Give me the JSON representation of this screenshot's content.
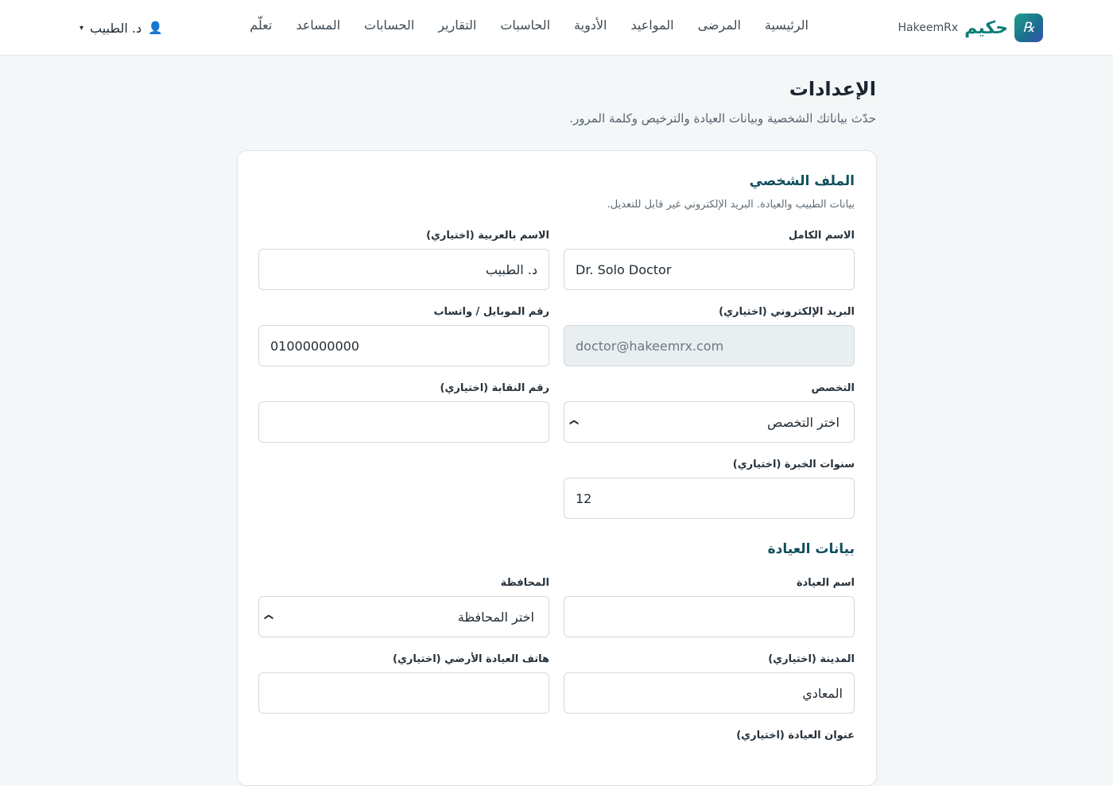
{
  "brand": {
    "name_ar": "حكيم",
    "name_en": "HakeemRx",
    "logo_glyph": "℞"
  },
  "nav": [
    {
      "id": "home",
      "label": "الرئيسية"
    },
    {
      "id": "patients",
      "label": "المرضى"
    },
    {
      "id": "appointments",
      "label": "المواعيد"
    },
    {
      "id": "medicines",
      "label": "الأدوية"
    },
    {
      "id": "calculators",
      "label": "الحاسبات"
    },
    {
      "id": "reports",
      "label": "التقارير"
    },
    {
      "id": "accounts",
      "label": "الحسابات"
    },
    {
      "id": "assistant",
      "label": "المساعد"
    },
    {
      "id": "learn",
      "label": "تعلّم"
    }
  ],
  "user": {
    "name": "د. الطبيب",
    "icon": "user-icon",
    "caret": "▾"
  },
  "page": {
    "title": "الإعدادات",
    "subtitle": "حدّث بياناتك الشخصية وبيانات العيادة والترخيص وكلمة المرور."
  },
  "profile": {
    "title": "الملف الشخصي",
    "subtitle": "بيانات الطبيب والعيادة. البريد الإلكتروني غير قابل للتعديل.",
    "full_name": {
      "label": "الاسم الكامل",
      "value": "Dr. Solo Doctor"
    },
    "arabic_name": {
      "label": "الاسم بالعربية (اختياري)",
      "value": "د. الطبيب"
    },
    "email": {
      "label": "البريد الإلكتروني (اختياري)",
      "value": "doctor@hakeemrx.com"
    },
    "mobile": {
      "label": "رقم الموبايل / واتساب",
      "value": "01000000000"
    },
    "specialty": {
      "label": "التخصص",
      "value": "اختر التخصص"
    },
    "syndicate": {
      "label": "رقم النقابة (اختياري)",
      "value": ""
    },
    "experience": {
      "label": "سنوات الخبرة (اختياري)",
      "value": "12"
    }
  },
  "clinic": {
    "title": "بيانات العيادة",
    "clinic_name": {
      "label": "اسم العيادة",
      "value": ""
    },
    "governorate": {
      "label": "المحافظة",
      "value": "اختر المحافظة"
    },
    "city": {
      "label": "المدينة (اختياري)",
      "value": "المعادي"
    },
    "landline": {
      "label": "هاتف العيادة الأرضي (اختياري)",
      "value": ""
    },
    "address": {
      "label": "عنوان العيادة (اختياري)"
    }
  },
  "colors": {
    "accent": "#0d7f77",
    "heading": "#0f4f5c",
    "page_bg": "#f4f7f8"
  }
}
